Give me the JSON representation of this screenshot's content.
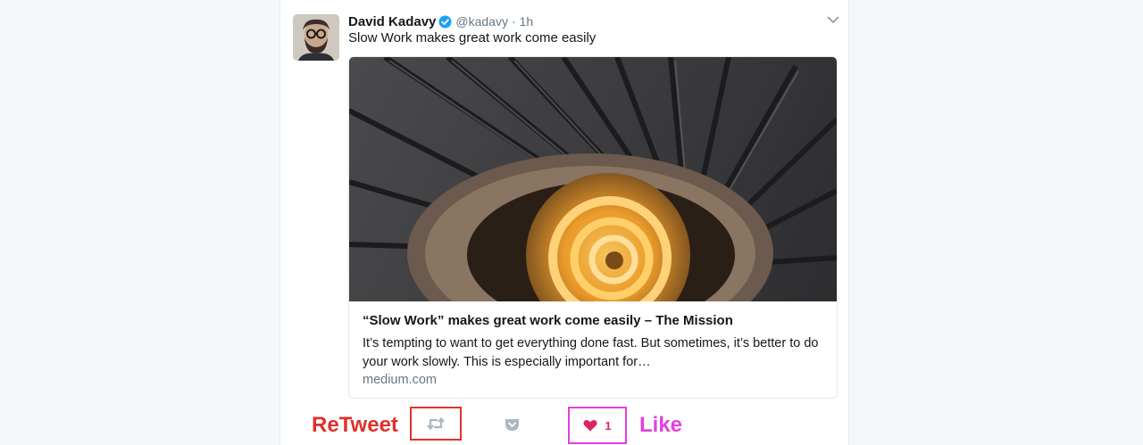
{
  "tweet": {
    "author_name": "David Kadavy",
    "handle": "@kadavy",
    "separator": "·",
    "timestamp": "1h",
    "text": "Slow Work makes great work come easily",
    "verified_icon": "verified-badge-icon",
    "avatar": "avatar-photo"
  },
  "card": {
    "title": "“Slow Work” makes great work come easily – The Mission",
    "description": "It’s tempting to want to get everything done fast. But sometimes, it’s better to do your work slowly. This is especially important for…",
    "domain": "medium.com",
    "image": "spiral-staircase-photo"
  },
  "actions": {
    "retweet_label": "ReTweet",
    "like_label": "Like",
    "like_count": "1",
    "retweet_icon": "retweet-icon",
    "save_icon": "pocket-save-icon",
    "like_icon": "heart-icon"
  },
  "colors": {
    "retweet_highlight": "#e0302b",
    "like_highlight": "#e040e0",
    "verified": "#1da1f2",
    "heart": "#e0245e"
  }
}
